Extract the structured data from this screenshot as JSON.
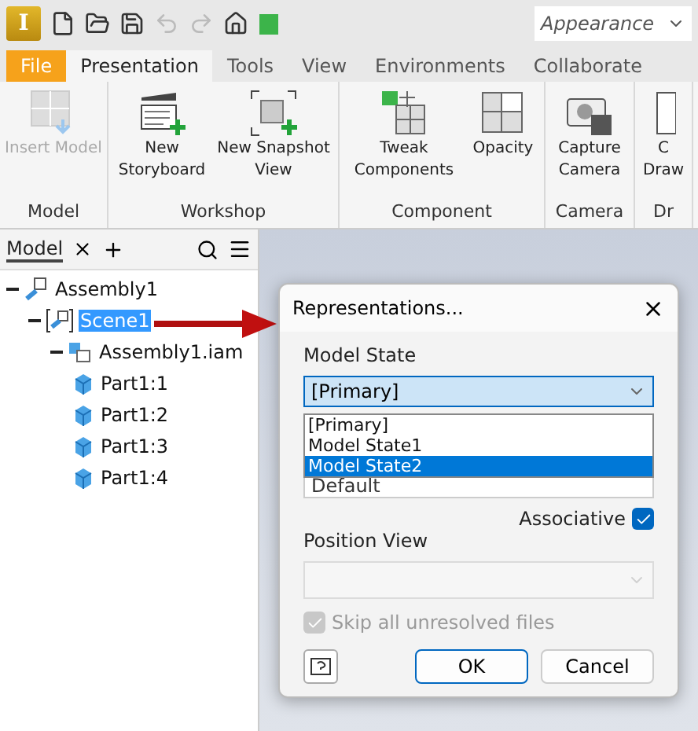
{
  "app": {
    "logo_letter": "I"
  },
  "quick_access": {
    "search": {
      "value": "Appearance"
    }
  },
  "ribbon_tabs": [
    {
      "label": "File",
      "kind": "file",
      "selected": false
    },
    {
      "label": "Presentation",
      "kind": "tab",
      "selected": true
    },
    {
      "label": "Tools",
      "kind": "tab",
      "selected": false
    },
    {
      "label": "View",
      "kind": "tab",
      "selected": false
    },
    {
      "label": "Environments",
      "kind": "tab",
      "selected": false
    },
    {
      "label": "Collaborate",
      "kind": "tab",
      "selected": false
    }
  ],
  "ribbon_panels": [
    {
      "title": "Model",
      "commands": [
        {
          "label": "Insert Model",
          "disabled": true
        }
      ]
    },
    {
      "title": "Workshop",
      "commands": [
        {
          "label": "New Storyboard",
          "disabled": false
        },
        {
          "label": "New Snapshot View",
          "disabled": false
        }
      ]
    },
    {
      "title": "Component",
      "commands": [
        {
          "label": "Tweak Components",
          "disabled": false
        },
        {
          "label": "Opacity",
          "disabled": false
        }
      ]
    },
    {
      "title": "Camera",
      "commands": [
        {
          "label": "Capture Camera",
          "disabled": false
        }
      ]
    },
    {
      "title": "Dr",
      "commands": [
        {
          "label": "C Draw",
          "disabled": false
        }
      ]
    }
  ],
  "browser": {
    "tabs": [
      {
        "label": "Model",
        "selected": true
      }
    ],
    "tree": [
      {
        "label": "Assembly1",
        "kind": "presentation",
        "selected": false,
        "expanded": true,
        "children": [
          {
            "label": "Scene1",
            "kind": "scene",
            "selected": true,
            "expanded": true,
            "children": [
              {
                "label": "Assembly1.iam",
                "kind": "assembly",
                "selected": false,
                "expanded": true,
                "children": [
                  {
                    "label": "Part1:1",
                    "kind": "part",
                    "selected": false
                  },
                  {
                    "label": "Part1:2",
                    "kind": "part",
                    "selected": false
                  },
                  {
                    "label": "Part1:3",
                    "kind": "part",
                    "selected": false
                  },
                  {
                    "label": "Part1:4",
                    "kind": "part",
                    "selected": false
                  }
                ]
              }
            ]
          }
        ]
      }
    ]
  },
  "dialog": {
    "title": "Representations...",
    "model_state": {
      "label": "Model State",
      "value": "[Primary]",
      "expanded": true,
      "options": [
        {
          "label": "[Primary]",
          "highlighted": false
        },
        {
          "label": "Model State1",
          "highlighted": false
        },
        {
          "label": "Model State2",
          "highlighted": true
        }
      ]
    },
    "design_view": {
      "value": "Default"
    },
    "associative": {
      "label": "Associative",
      "checked": true
    },
    "position_view": {
      "label": "Position View",
      "disabled": true
    },
    "skip_unresolved": {
      "label": "Skip all unresolved files",
      "checked": true,
      "disabled": true
    },
    "buttons": [
      {
        "label": "OK",
        "kind": "default"
      },
      {
        "label": "Cancel",
        "kind": "normal"
      }
    ]
  }
}
